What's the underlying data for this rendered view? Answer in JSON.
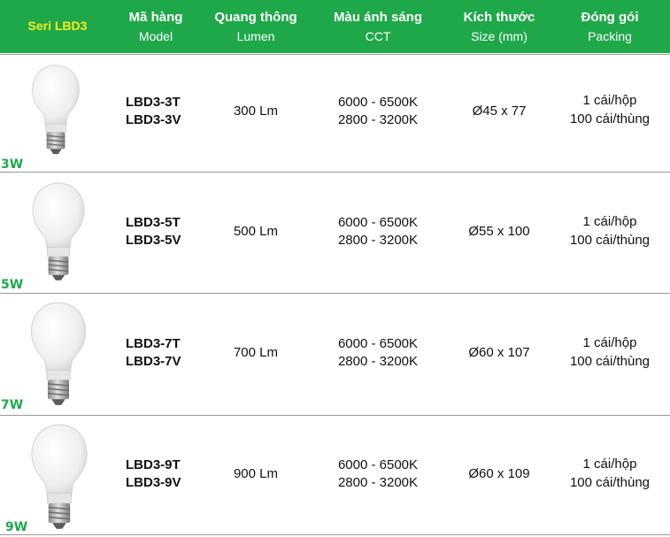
{
  "header": {
    "seri": "Seri LBD3",
    "columns": [
      {
        "vi": "Mã hàng",
        "en": "Model"
      },
      {
        "vi": "Quang thông",
        "en": "Lumen"
      },
      {
        "vi": "Màu ánh sáng",
        "en": "CCT"
      },
      {
        "vi": "Kích thước",
        "en": "Size (mm)"
      },
      {
        "vi": "Đóng gói",
        "en": "Packing"
      }
    ]
  },
  "rows": [
    {
      "watt": "3W",
      "model_1": "LBD3-3T",
      "model_2": "LBD3-3V",
      "lumen": "300 Lm",
      "cct_1": "6000 - 6500K",
      "cct_2": "2800 - 3200K",
      "size": "Ø45 x 77",
      "pack_1": "1 cái/hộp",
      "pack_2": "100 cái/thùng"
    },
    {
      "watt": "5W",
      "model_1": "LBD3-5T",
      "model_2": "LBD3-5V",
      "lumen": "500 Lm",
      "cct_1": "6000 - 6500K",
      "cct_2": "2800 - 3200K",
      "size": "Ø55 x 100",
      "pack_1": "1 cái/hộp",
      "pack_2": "100 cái/thùng"
    },
    {
      "watt": "7W",
      "model_1": "LBD3-7T",
      "model_2": "LBD3-7V",
      "lumen": "700 Lm",
      "cct_1": "6000 - 6500K",
      "cct_2": "2800 - 3200K",
      "size": "Ø60 x 107",
      "pack_1": "1 cái/hộp",
      "pack_2": "100 cái/thùng"
    },
    {
      "watt": "9W",
      "model_1": "LBD3-9T",
      "model_2": "LBD3-9V",
      "lumen": "900 Lm",
      "cct_1": "6000 - 6500K",
      "cct_2": "2800 - 3200K",
      "size": "Ø60 x 109",
      "pack_1": "1 cái/hộp",
      "pack_2": "100 cái/thùng"
    }
  ],
  "colors": {
    "header_bg": "#1fa84a",
    "seri_text": "#f4ef1c",
    "watt_text": "#1fa84a"
  },
  "icons": [
    "led-bulb-icon"
  ]
}
